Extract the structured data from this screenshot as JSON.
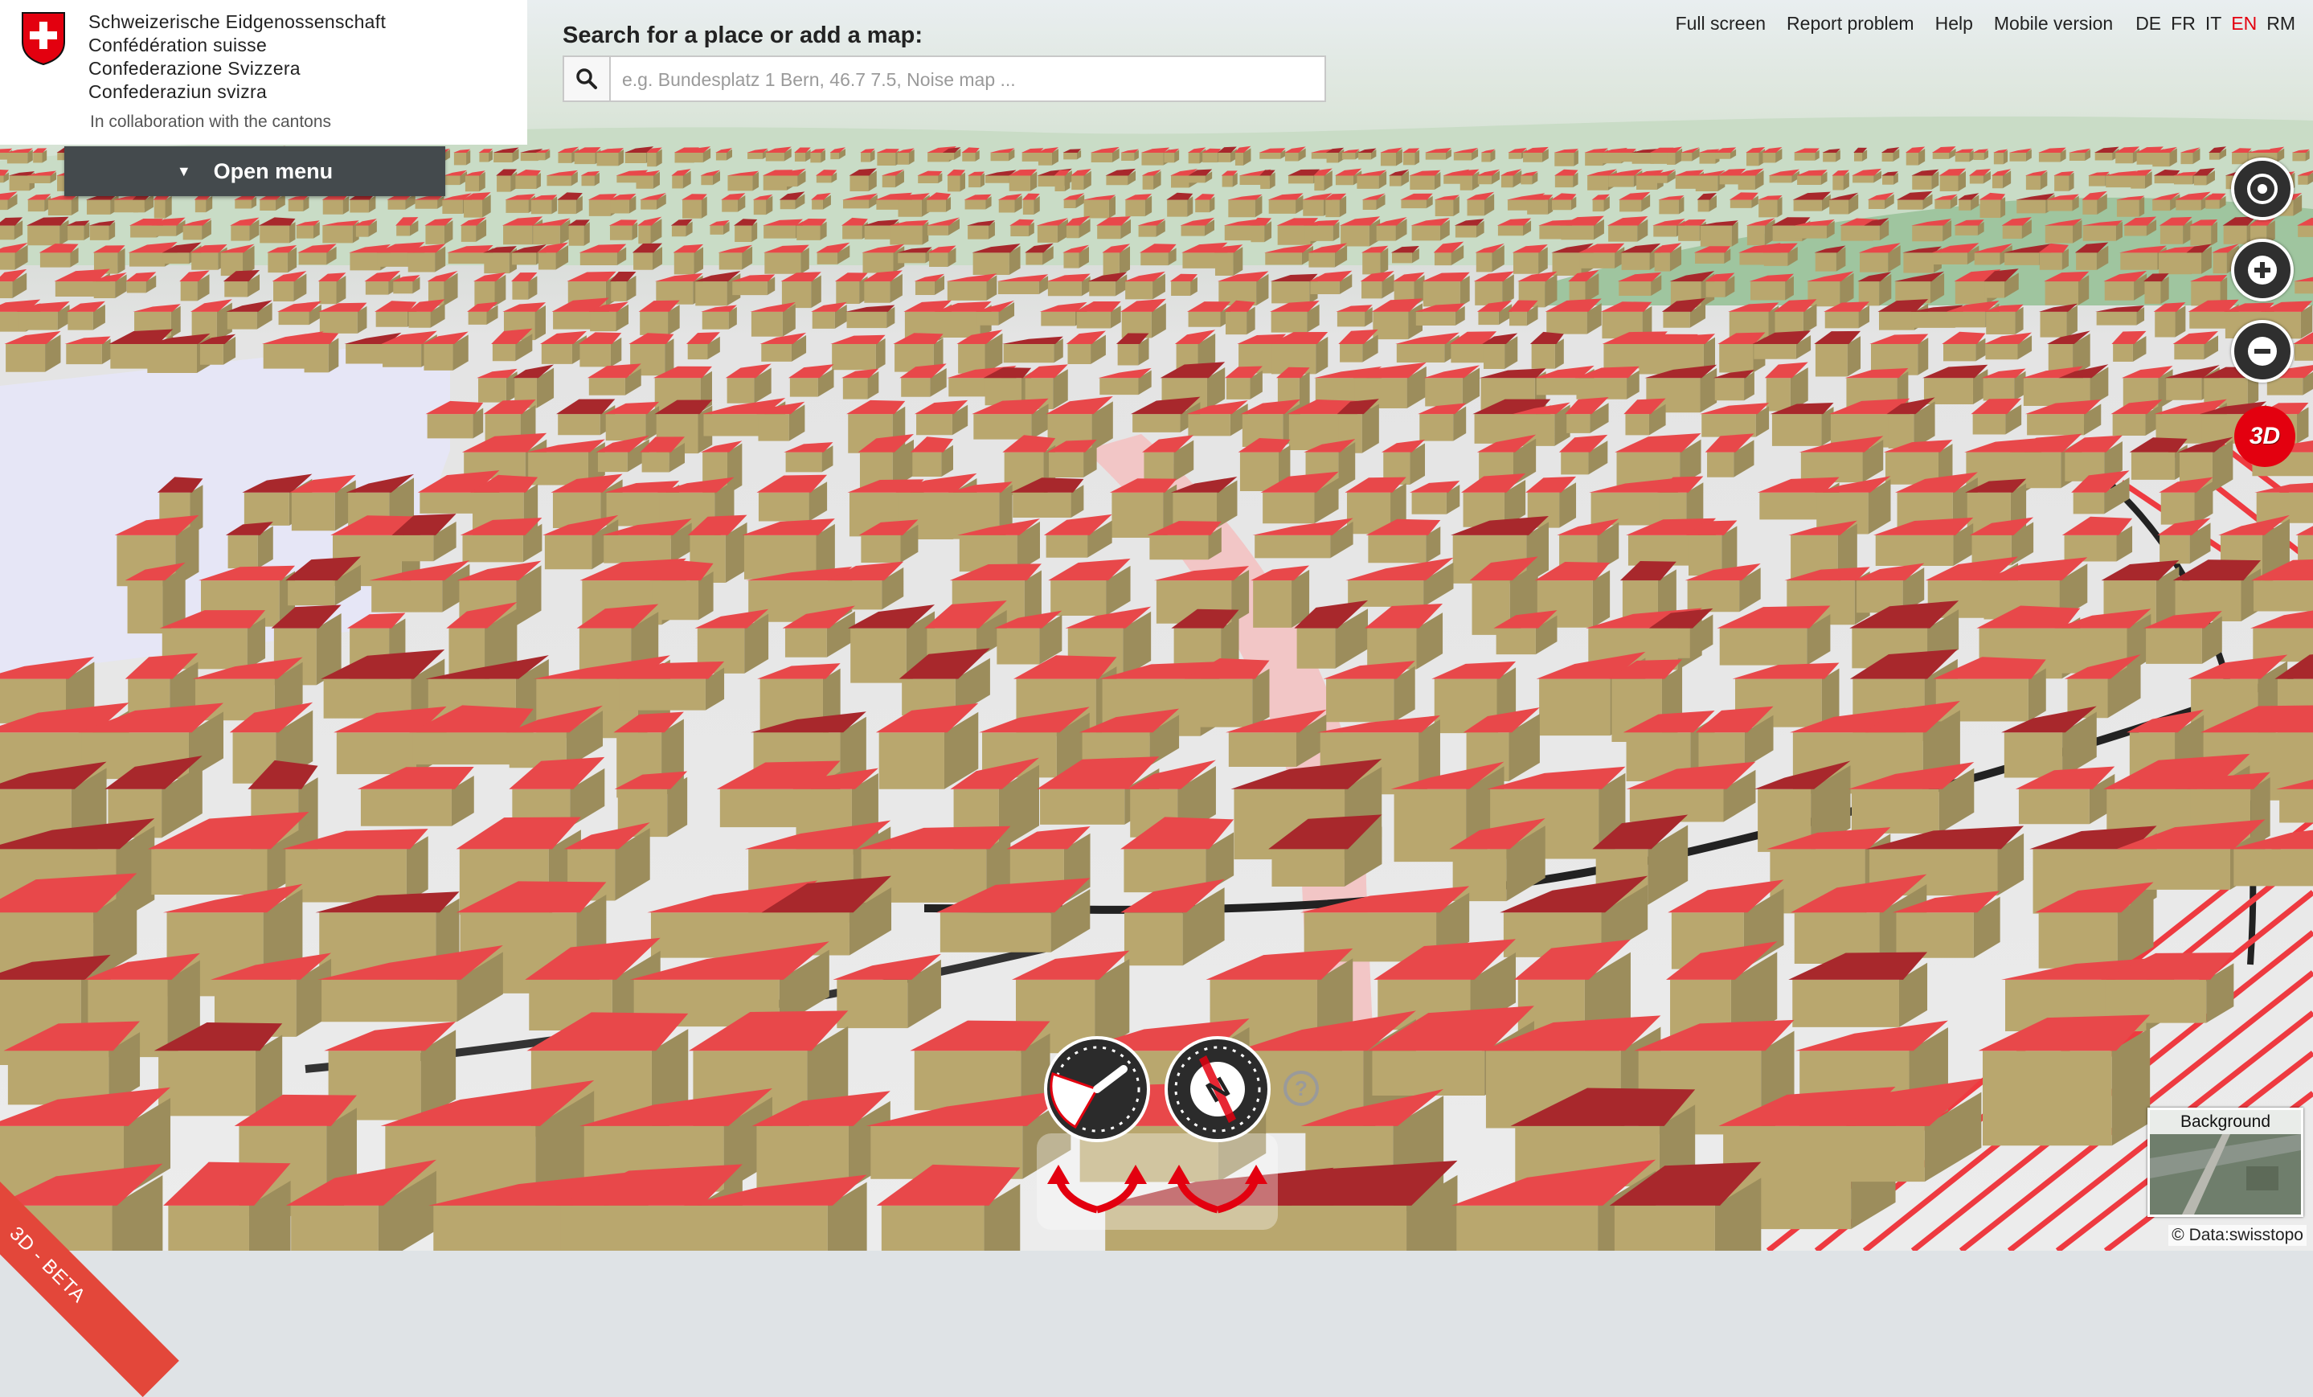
{
  "header": {
    "federation_lines": [
      "Schweizerische Eidgenossenschaft",
      "Confédération suisse",
      "Confederazione Svizzera",
      "Confederaziun svizra"
    ],
    "collaboration": "In collaboration with the cantons",
    "search_label": "Search for a place or add a map:",
    "search_placeholder": "e.g. Bundesplatz 1 Bern, 46.7 7.5, Noise map ...",
    "search_value": ""
  },
  "top_links": {
    "full_screen": "Full screen",
    "report_problem": "Report problem",
    "help": "Help",
    "mobile_version": "Mobile version"
  },
  "languages": {
    "items": [
      "DE",
      "FR",
      "IT",
      "EN",
      "RM"
    ],
    "active": "EN"
  },
  "menu": {
    "open_label": "Open menu"
  },
  "controls": {
    "locate_icon": "geolocation-icon",
    "zoom_in_icon": "plus-icon",
    "zoom_out_icon": "minus-icon",
    "toggle_3d_label": "3D"
  },
  "background_selector": {
    "label": "Background"
  },
  "attribution": "© Data:swisstopo",
  "beta_label": "3D - BETA",
  "colors": {
    "swiss_red": "#e3000f",
    "roof_red": "#e8484a",
    "wall_khaki": "#b9a76e",
    "menu_dark": "#444a4d",
    "beta_ribbon": "#e3473a"
  }
}
